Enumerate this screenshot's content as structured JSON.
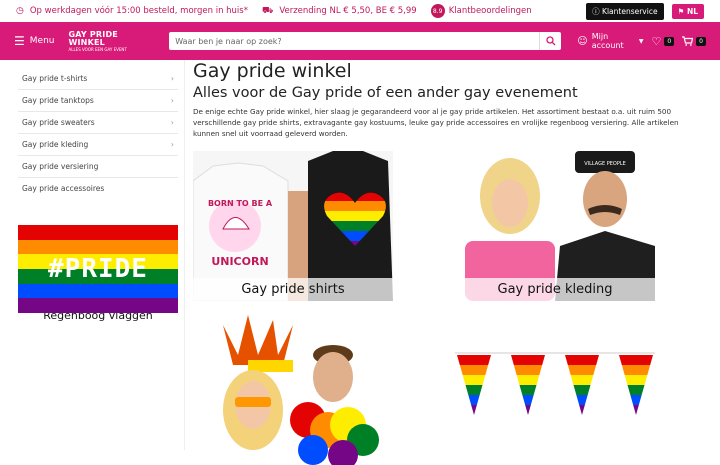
{
  "topbar": {
    "usp1": "Op werkdagen vóór 15:00 besteld, morgen in huis*",
    "usp2": "Verzending NL € 5,50, BE € 5,99",
    "rating": "8.9",
    "reviews": "Klantbeoordelingen",
    "service": "Klantenservice",
    "lang": "NL"
  },
  "navbar": {
    "menu": "Menu",
    "logo_line1": "GAY PRIDE WINKEL",
    "logo_line2": "ALLES VOOR EEN GAY EVENT",
    "search_placeholder": "Waar ben je naar op zoek?",
    "account": "Mijn account",
    "wishlist_count": "0",
    "cart_count": "0"
  },
  "sidebar": {
    "items": [
      {
        "label": "Gay pride t-shirts",
        "chev": true
      },
      {
        "label": "Gay pride tanktops",
        "chev": true
      },
      {
        "label": "Gay pride sweaters",
        "chev": true
      },
      {
        "label": "Gay pride kleding",
        "chev": true
      },
      {
        "label": "Gay pride versiering",
        "chev": false
      },
      {
        "label": "Gay pride accessoires",
        "chev": false
      }
    ],
    "promo_text": "#PRIDE",
    "promo_caption": "Regenboog vlaggen"
  },
  "main": {
    "title": "Gay pride winkel",
    "subtitle": "Alles voor de Gay pride of een ander gay evenement",
    "intro": "De enige echte Gay pride winkel, hier slaag je gegarandeerd voor al je gay pride artikelen. Het assortiment bestaat o.a. uit ruim 500 verschillende gay pride shirts, extravagante gay kostuums, leuke gay pride accessoires en vrolijke regenboog versiering. Alle artikelen kunnen snel uit voorraad geleverd worden.",
    "tiles": [
      {
        "caption": "Gay pride shirts",
        "shirt_text1": "BORN TO BE A",
        "shirt_text2": "UNICORN"
      },
      {
        "caption": "Gay pride kleding",
        "hat_text": "VILLAGE PEOPLE"
      },
      {
        "caption": ""
      },
      {
        "caption": ""
      }
    ]
  },
  "colors": {
    "brand": "#d81b78",
    "rainbow": [
      "#e40303",
      "#ff8c00",
      "#ffed00",
      "#008026",
      "#004dff",
      "#750787"
    ]
  }
}
